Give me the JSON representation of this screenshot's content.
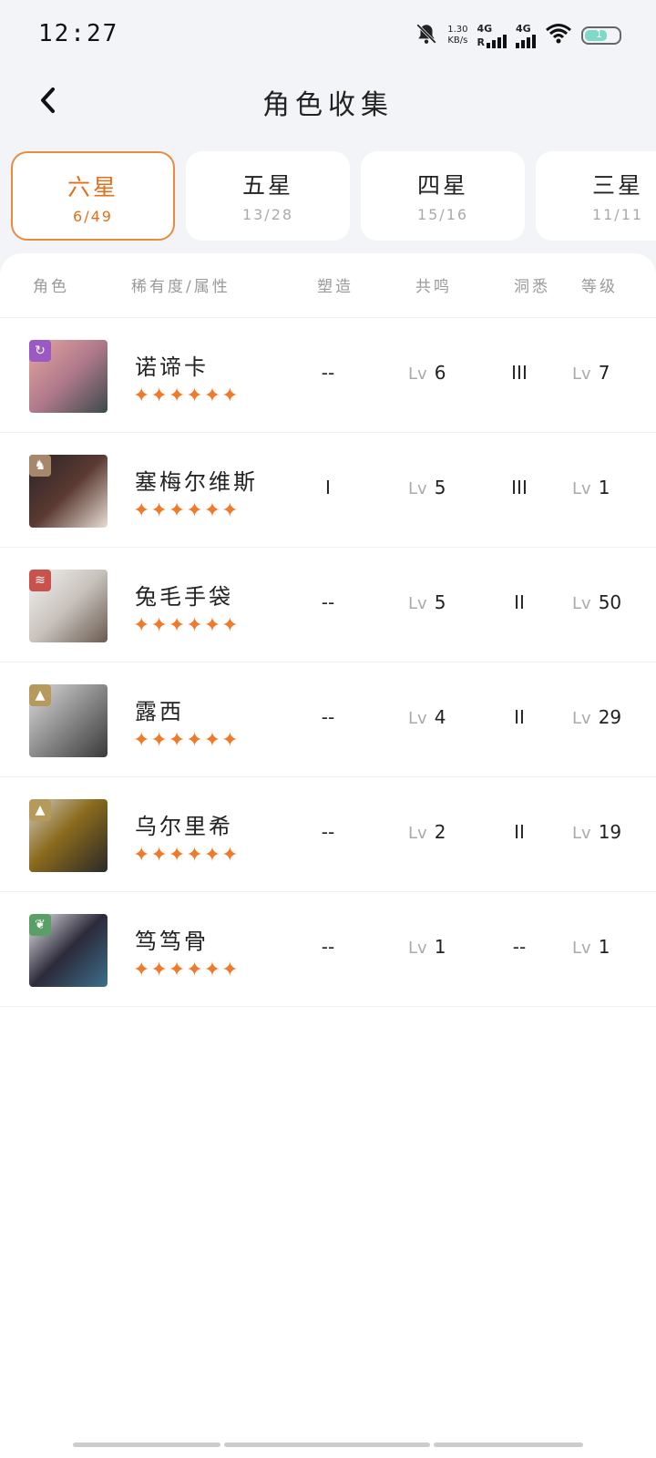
{
  "status": {
    "time": "12:27",
    "speed_top": "1.30",
    "speed_bottom": "KB/s",
    "net1": "4G",
    "net1_prefix": "R",
    "net2": "4G",
    "battery": "1"
  },
  "header": {
    "title": "角色收集"
  },
  "tabs": [
    {
      "name": "六星",
      "count": "6/49",
      "active": true
    },
    {
      "name": "五星",
      "count": "13/28",
      "active": false
    },
    {
      "name": "四星",
      "count": "15/16",
      "active": false
    },
    {
      "name": "三星",
      "count": "11/11",
      "active": false
    }
  ],
  "columns": {
    "character": "角色",
    "rarity": "稀有度/属性",
    "shaping": "塑造",
    "resonance": "共鸣",
    "insight": "洞悉",
    "level": "等级"
  },
  "level_prefix": "Lv",
  "rows": [
    {
      "name": "诺谛卡",
      "stars": "✦✦✦✦✦✦",
      "shaping": "--",
      "resonance": "6",
      "insight": "III",
      "level": "7",
      "attr_icon": "spiral-icon",
      "attr_color": "#9b59c4"
    },
    {
      "name": "塞梅尔维斯",
      "stars": "✦✦✦✦✦✦",
      "shaping": "I",
      "resonance": "5",
      "insight": "III",
      "level": "1",
      "attr_icon": "beast-icon",
      "attr_color": "#a7876a"
    },
    {
      "name": "兔毛手袋",
      "stars": "✦✦✦✦✦✦",
      "shaping": "--",
      "resonance": "5",
      "insight": "II",
      "level": "50",
      "attr_icon": "claw-icon",
      "attr_color": "#c9534c"
    },
    {
      "name": "露西",
      "stars": "✦✦✦✦✦✦",
      "shaping": "--",
      "resonance": "4",
      "insight": "II",
      "level": "29",
      "attr_icon": "rock-icon",
      "attr_color": "#b69a5c"
    },
    {
      "name": "乌尔里希",
      "stars": "✦✦✦✦✦✦",
      "shaping": "--",
      "resonance": "2",
      "insight": "II",
      "level": "19",
      "attr_icon": "rock-icon",
      "attr_color": "#b69a5c"
    },
    {
      "name": "笃笃骨",
      "stars": "✦✦✦✦✦✦",
      "shaping": "--",
      "resonance": "1",
      "insight": "--",
      "level": "1",
      "attr_icon": "leaf-icon",
      "attr_color": "#5aa066"
    }
  ]
}
